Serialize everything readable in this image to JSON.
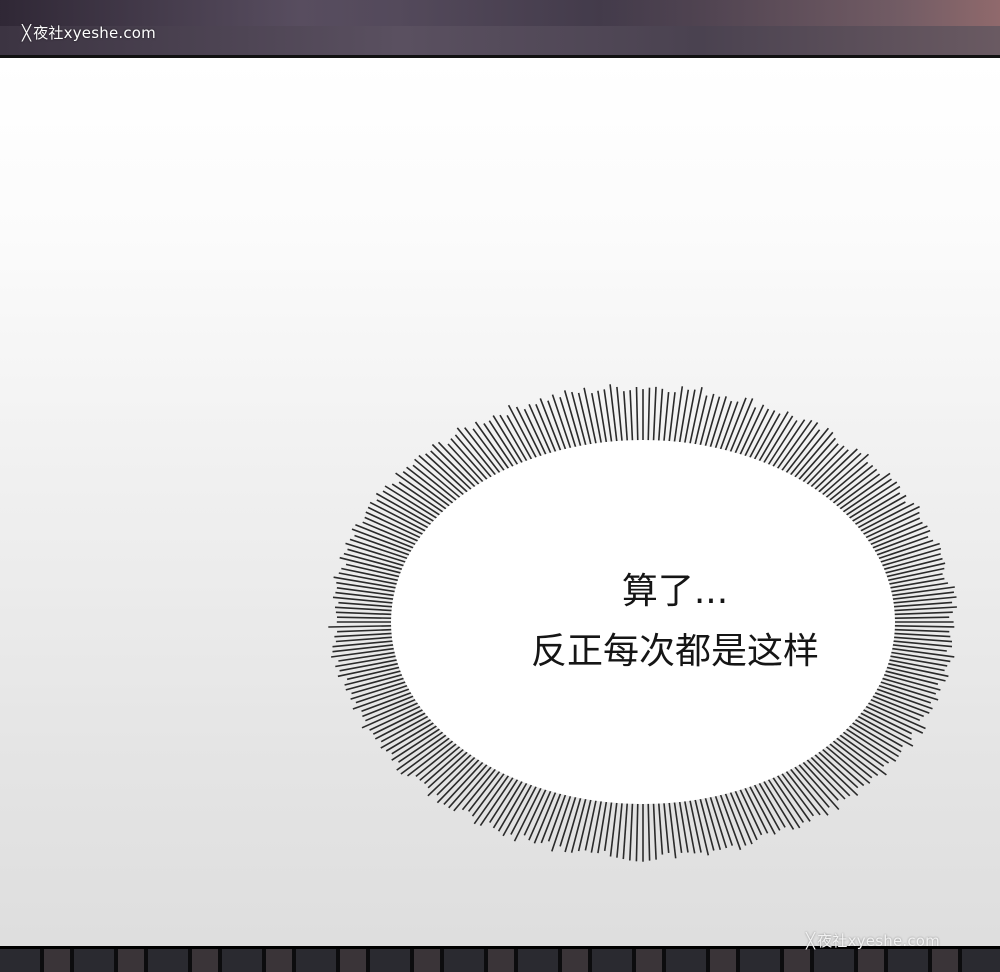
{
  "watermark": {
    "top_text": "夜社xyeshe.com",
    "bottom_text": "夜社xyeshe.com",
    "icon": "x-logo-icon"
  },
  "speech_bubble": {
    "line1": "算了...",
    "line2": "反正每次都是这样"
  },
  "colors": {
    "bubble_fill": "#ffffff",
    "burst_stroke": "#2a2a2a",
    "text": "#151515"
  }
}
